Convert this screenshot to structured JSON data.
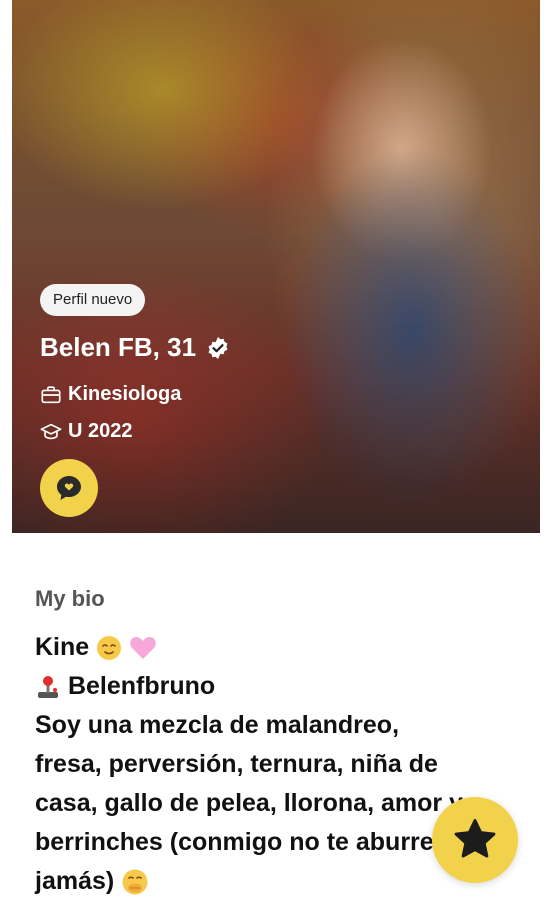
{
  "profile": {
    "badge": "Perfil nuevo",
    "name_age": "Belen FB, 31",
    "job": "Kinesiologa",
    "education": "U 2022"
  },
  "bio": {
    "label": "My bio",
    "lines": [
      "Kine ",
      " Belenfbruno",
      "Soy una mezcla de malandreo,",
      "fresa, perversión, ternura, niña de",
      "casa, gallo de pelea, llorona, amor y",
      "berrinches (conmigo no te aburres",
      "jamás) "
    ]
  },
  "colors": {
    "accent": "#f2d24b",
    "text": "#111111",
    "muted": "#555555"
  },
  "icons": [
    "verified-icon",
    "briefcase-icon",
    "graduation-cap-icon",
    "chat-bubble-icon",
    "star-icon",
    "relieved-emoji",
    "pink-heart-emoji",
    "joystick-emoji",
    "hand-over-mouth-emoji"
  ]
}
